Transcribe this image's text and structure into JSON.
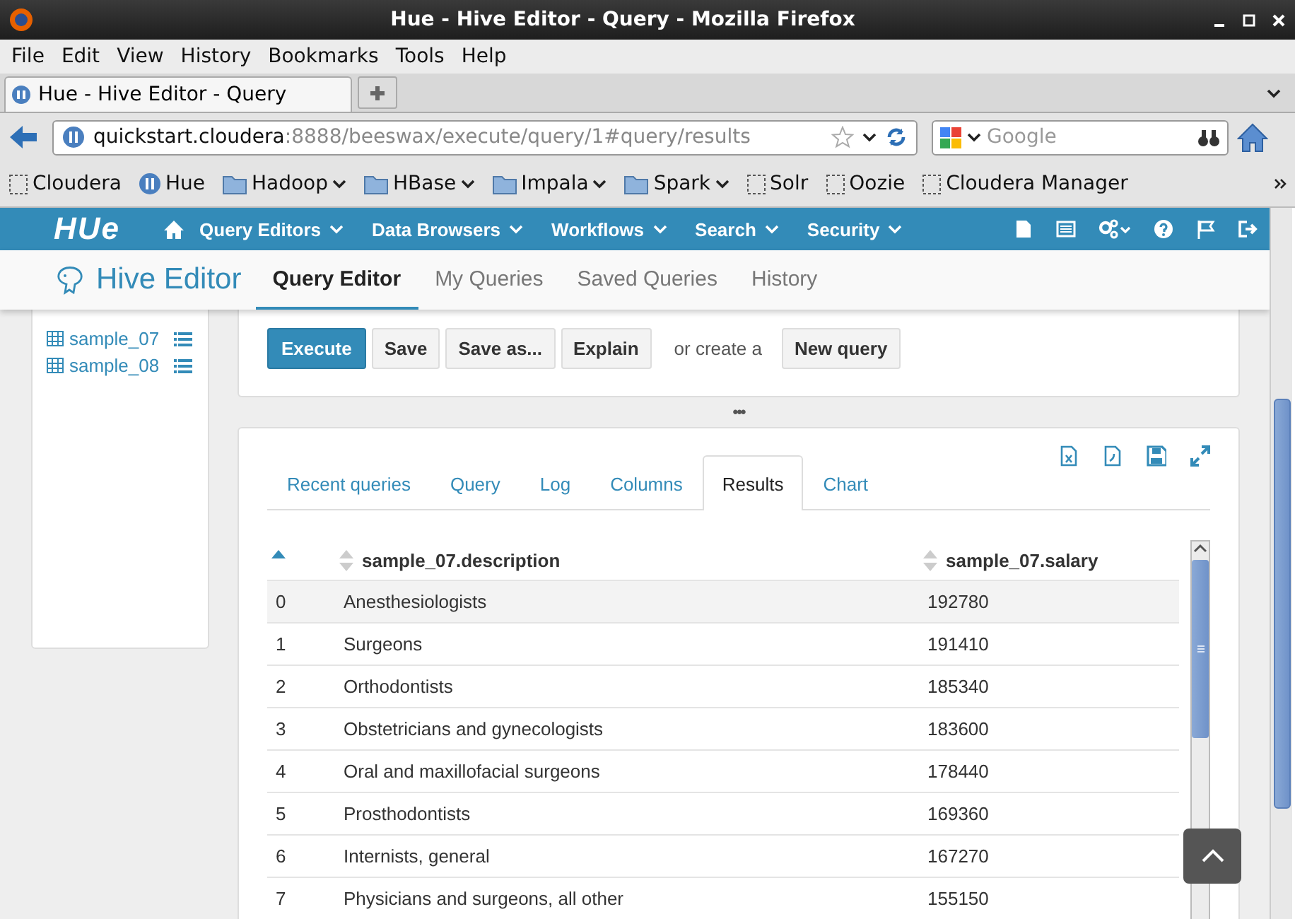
{
  "window": {
    "title": "Hue - Hive Editor - Query - Mozilla Firefox"
  },
  "menu": [
    "File",
    "Edit",
    "View",
    "History",
    "Bookmarks",
    "Tools",
    "Help"
  ],
  "browser_tab": {
    "title": "Hue - Hive Editor - Query"
  },
  "address_bar": {
    "host": "quickstart.cloudera",
    "path": ":8888/beeswax/execute/query/1#query/results"
  },
  "search_field": {
    "placeholder": "Google"
  },
  "bookmarks": [
    {
      "label": "Cloudera",
      "kind": "page"
    },
    {
      "label": "Hue",
      "kind": "hue"
    },
    {
      "label": "Hadoop",
      "kind": "folder"
    },
    {
      "label": "HBase",
      "kind": "folder"
    },
    {
      "label": "Impala",
      "kind": "folder"
    },
    {
      "label": "Spark",
      "kind": "folder"
    },
    {
      "label": "Solr",
      "kind": "page"
    },
    {
      "label": "Oozie",
      "kind": "page"
    },
    {
      "label": "Cloudera Manager",
      "kind": "page"
    }
  ],
  "hue_nav": {
    "logo": "HUe",
    "menus": [
      "Query Editors",
      "Data Browsers",
      "Workflows",
      "Search",
      "Security"
    ]
  },
  "app_header": {
    "title": "Hive Editor",
    "tabs": [
      {
        "label": "Query Editor",
        "selected": true
      },
      {
        "label": "My Queries",
        "selected": false
      },
      {
        "label": "Saved Queries",
        "selected": false
      },
      {
        "label": "History",
        "selected": false
      }
    ]
  },
  "sidebar": {
    "tables": [
      "sample_07",
      "sample_08"
    ]
  },
  "toolbar": {
    "buttons": [
      {
        "label": "Execute",
        "kind": "primary"
      },
      {
        "label": "Save",
        "kind": "default"
      },
      {
        "label": "Save as...",
        "kind": "default"
      },
      {
        "label": "Explain",
        "kind": "default"
      }
    ],
    "note": "or create a",
    "new_button": "New query"
  },
  "divider_handle": "•••",
  "result_tabs": [
    {
      "label": "Recent queries",
      "selected": false
    },
    {
      "label": "Query",
      "selected": false
    },
    {
      "label": "Log",
      "selected": false
    },
    {
      "label": "Columns",
      "selected": false
    },
    {
      "label": "Results",
      "selected": true
    },
    {
      "label": "Chart",
      "selected": false
    }
  ],
  "table": {
    "columns": [
      {
        "sorted": true
      },
      {
        "label": "sample_07.description",
        "sorted": false
      },
      {
        "label": "sample_07.salary",
        "sorted": false
      }
    ],
    "rows": [
      {
        "cells": [
          "0",
          "Anesthesiologists",
          "192780"
        ],
        "selected": true
      },
      {
        "cells": [
          "1",
          "Surgeons",
          "191410"
        ],
        "selected": false
      },
      {
        "cells": [
          "2",
          "Orthodontists",
          "185340"
        ],
        "selected": false
      },
      {
        "cells": [
          "3",
          "Obstetricians and gynecologists",
          "183600"
        ],
        "selected": false
      },
      {
        "cells": [
          "4",
          "Oral and maxillofacial surgeons",
          "178440"
        ],
        "selected": false
      },
      {
        "cells": [
          "5",
          "Prosthodontists",
          "169360"
        ],
        "selected": false
      },
      {
        "cells": [
          "6",
          "Internists, general",
          "167270"
        ],
        "selected": false
      },
      {
        "cells": [
          "7",
          "Physicians and surgeons, all other",
          "155150"
        ],
        "selected": false
      }
    ]
  }
}
